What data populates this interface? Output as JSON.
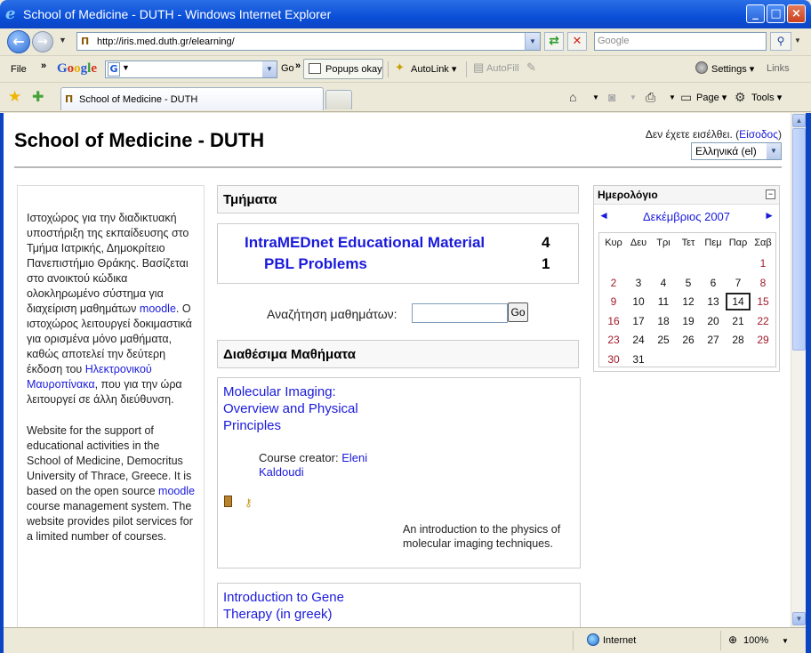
{
  "window": {
    "title": "School of Medicine - DUTH - Windows Internet Explorer",
    "controls": {
      "minimize": "_",
      "maximize": "□",
      "close": "×"
    }
  },
  "address_bar": {
    "url": "http://iris.med.duth.gr/elearning/",
    "search_placeholder": "Google"
  },
  "google_toolbar": {
    "file": "File",
    "logo": "Google",
    "g_icon": "G",
    "go": "Go",
    "popups": "Popups okay",
    "autolink": "AutoLink",
    "autofill": "AutoFill",
    "settings": "Settings",
    "links": "Links"
  },
  "tabs": {
    "active_tab": "School of Medicine - DUTH",
    "tools": {
      "page": "Page",
      "tools": "Tools"
    }
  },
  "status_bar": {
    "zone": "Internet",
    "zoom": "100%"
  },
  "page": {
    "site_title": "School of Medicine - DUTH",
    "login": {
      "prefix": "Δεν έχετε εισέλθει. (",
      "link": "Είσοδος",
      "suffix": ")"
    },
    "language": "Ελληνικά (el)",
    "intro_greek": {
      "text1": "Ιστοχώρος για την διαδικτυακή υποστήριξη της εκπαίδευσης στο Τμήμα Ιατρικής, Δημοκρίτειο Πανεπιστήμιο Θράκης. Βασίζεται στο ανοικτού κώδικα ολοκληρωμένο σύστημα για διαχείριση μαθημάτων ",
      "link1": "moodle",
      "text2": ". Ο ιστοχώρος λειτουργεί δοκιμαστικά για ορισμένα μόνο μαθήματα, καθώς αποτελεί την δεύτερη έκδοση του ",
      "link2": "Ηλεκτρονικού Μαυροπίνακα",
      "text3": ", που για την ώρα λειτουργεί σε άλλη διεύθυνση."
    },
    "intro_english": {
      "text1": "Website for the support of educational activities in the School of Medicine, Democritus University of Thrace, Greece. It is based on the open source ",
      "link1": "moodle",
      "text2": " course management system. The website provides pilot services for a limited number of courses."
    },
    "categories_header": "Τμήματα",
    "categories": [
      {
        "name": "IntraMEDnet Educational Material",
        "count": "4"
      },
      {
        "name": "PBL Problems",
        "count": "1"
      }
    ],
    "search": {
      "label": "Αναζήτηση μαθημάτων:",
      "button": "Go"
    },
    "courses_header": "Διαθέσιμα Μαθήματα",
    "courses": [
      {
        "name": "Molecular Imaging: Overview and Physical Principles",
        "creator_label": "Course creator: ",
        "creator": "Eleni Kaldoudi",
        "summary": "An introduction to the physics of molecular imaging techniques."
      },
      {
        "name": "Introduction to Gene Therapy (in greek)"
      }
    ]
  },
  "calendar": {
    "title": "Ημερολόγιο",
    "hide": "−",
    "prev": "◄",
    "next": "►",
    "month": "Δεκέμβριος 2007",
    "day_names": [
      "Κυρ",
      "Δευ",
      "Τρι",
      "Τετ",
      "Πεμ",
      "Παρ",
      "Σαβ"
    ],
    "first_weekday_index": 6,
    "days_in_month": 31,
    "today": 14
  },
  "icons": {
    "ie_logo": "ie-logo-icon",
    "back": "back-arrow-icon",
    "forward": "forward-arrow-icon",
    "refresh": "refresh-icon",
    "stop": "stop-icon",
    "search": "search-magnifier-icon",
    "favorites": "favorites-star-icon",
    "add_favorites": "add-favorites-icon",
    "home": "home-icon",
    "feeds": "rss-feed-icon",
    "print": "printer-icon",
    "globe": "globe-icon",
    "guest_access": "door-icon",
    "enrol_key": "key-icon"
  },
  "colors": {
    "link": "#1a1adc",
    "weekend": "#a11a2a",
    "titlebar": "#0a4fd8"
  }
}
